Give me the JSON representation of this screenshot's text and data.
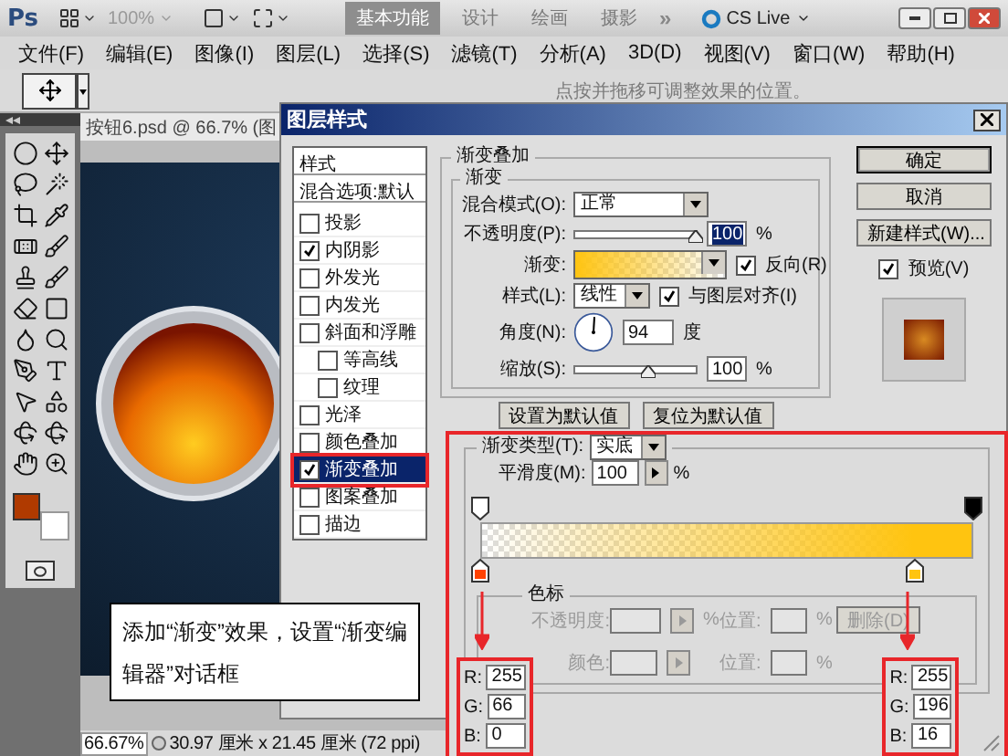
{
  "app_bar": {
    "logo": "Ps",
    "zoom": "100%",
    "workspaces": [
      {
        "label": "基本功能",
        "selected": true
      },
      {
        "label": "设计",
        "selected": false
      },
      {
        "label": "绘画",
        "selected": false
      },
      {
        "label": "摄影",
        "selected": false
      }
    ],
    "more": "»",
    "cs_live": "CS Live"
  },
  "menu": [
    "文件(F)",
    "编辑(E)",
    "图像(I)",
    "图层(L)",
    "选择(S)",
    "滤镜(T)",
    "分析(A)",
    "3D(D)",
    "视图(V)",
    "窗口(W)",
    "帮助(H)"
  ],
  "options_bar": {
    "hint": "点按并拖移可调整效果的位置。"
  },
  "document": {
    "tab": "按钮6.psd @ 66.7% (图",
    "zoom": "66.67%",
    "size": "30.97 厘米 x 21.45 厘米 (72 ppi)"
  },
  "layer_style": {
    "title": "图层样式",
    "styles_header": "样式",
    "blend_options": "混合选项:默认",
    "effects": [
      {
        "label": "投影",
        "checked": false,
        "selected": false
      },
      {
        "label": "内阴影",
        "checked": true,
        "selected": false
      },
      {
        "label": "外发光",
        "checked": false,
        "selected": false
      },
      {
        "label": "内发光",
        "checked": false,
        "selected": false
      },
      {
        "label": "斜面和浮雕",
        "checked": false,
        "selected": false,
        "children": [
          {
            "label": "等高线",
            "checked": false,
            "selected": false
          },
          {
            "label": "纹理",
            "checked": false,
            "selected": false
          }
        ]
      },
      {
        "label": "光泽",
        "checked": false,
        "selected": false
      },
      {
        "label": "颜色叠加",
        "checked": false,
        "selected": false
      },
      {
        "label": "渐变叠加",
        "checked": true,
        "selected": true
      },
      {
        "label": "图案叠加",
        "checked": false,
        "selected": false
      },
      {
        "label": "描边",
        "checked": false,
        "selected": false
      }
    ],
    "section_title": "渐变叠加",
    "group_title": "渐变",
    "blend_mode": {
      "label": "混合模式(O):",
      "value": "正常"
    },
    "opacity": {
      "label": "不透明度(P):",
      "level": 1,
      "value": "100",
      "unit": "%"
    },
    "gradient": {
      "label": "渐变:",
      "reverse": {
        "label": "反向(R)",
        "checked": true
      }
    },
    "style": {
      "label": "样式(L):",
      "value": "线性",
      "align": {
        "label": "与图层对齐(I)",
        "checked": true
      }
    },
    "angle": {
      "label": "角度(N):",
      "value": "94",
      "unit": "度"
    },
    "scale": {
      "label": "缩放(S):",
      "level": 0.6,
      "value": "100",
      "unit": "%"
    },
    "set_default": "设置为默认值",
    "reset_default": "复位为默认值",
    "buttons": [
      "确定",
      "取消",
      "新建样式(W)..."
    ],
    "preview": {
      "label": "预览(V)",
      "checked": true
    }
  },
  "gradient_editor": {
    "type_label": "渐变类型(T):",
    "type_value": "实底",
    "smoothness_label": "平滑度(M):",
    "smoothness_value": "100",
    "smoothness_unit": "%",
    "opacity_stops": [
      {
        "level": 0,
        "opaque": false
      },
      {
        "level": 1,
        "opaque": true
      }
    ],
    "color_stops": [
      {
        "level": 0,
        "color": "#ff4200",
        "channels": [
          {
            "label": "R:",
            "value": "255"
          },
          {
            "label": "G:",
            "value": "66"
          },
          {
            "label": "B:",
            "value": "0"
          }
        ]
      },
      {
        "level": 0.88,
        "color": "#ffc410",
        "channels": [
          {
            "label": "R:",
            "value": "255"
          },
          {
            "label": "G:",
            "value": "196"
          },
          {
            "label": "B:",
            "value": "16"
          }
        ]
      }
    ],
    "stops_title": "色标",
    "fields_disabled": true,
    "stop_rows": [
      {
        "label": "不透明度:",
        "unit": "%",
        "location_label": "位置:",
        "location_unit": "%",
        "button": "删除(D)"
      },
      {
        "label": "颜色:",
        "location_label": "位置:",
        "location_unit": "%"
      }
    ]
  },
  "callout": "添加“渐变”效果，设置“渐变编辑器”对话框"
}
